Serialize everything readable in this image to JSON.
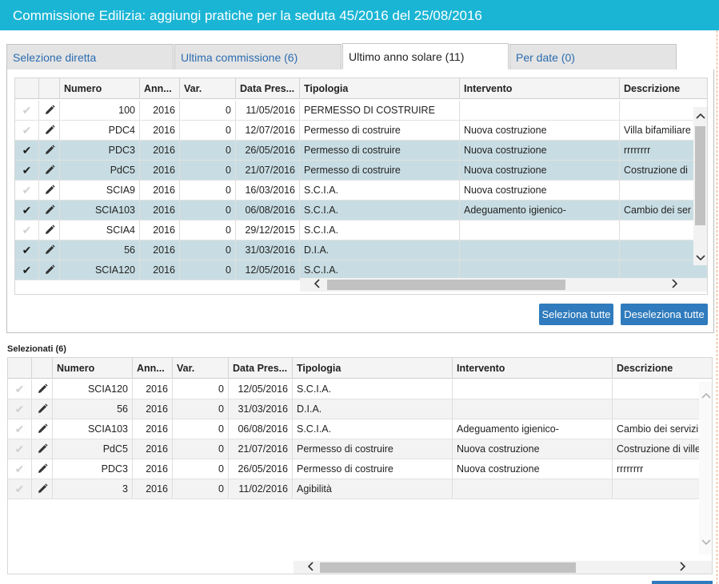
{
  "dialog": {
    "title": "Commissione Edilizia: aggiungi pratiche per la seduta 45/2016 del 25/08/2016"
  },
  "tabs": [
    {
      "label": "Selezione diretta",
      "active": false
    },
    {
      "label": "Ultima commissione (6)",
      "active": false
    },
    {
      "label": "Ultimo anno solare (11)",
      "active": true
    },
    {
      "label": "Per date (0)",
      "active": false
    }
  ],
  "columns": [
    "",
    "",
    "Numero",
    "Ann...",
    "Var.",
    "Data Pres...",
    "Tipologia",
    "Intervento",
    "Descrizione"
  ],
  "top_rows": [
    {
      "checked": false,
      "numero": "100",
      "anno": "2016",
      "var": "0",
      "data": "11/05/2016",
      "tipologia": "PERMESSO DI COSTRUIRE",
      "intervento": "",
      "descrizione": ""
    },
    {
      "checked": false,
      "numero": "PDC4",
      "anno": "2016",
      "var": "0",
      "data": "12/07/2016",
      "tipologia": "Permesso di costruire",
      "intervento": "Nuova costruzione",
      "descrizione": "Villa bifamiliare"
    },
    {
      "checked": true,
      "numero": "PDC3",
      "anno": "2016",
      "var": "0",
      "data": "26/05/2016",
      "tipologia": "Permesso di costruire",
      "intervento": "Nuova costruzione",
      "descrizione": "rrrrrrrr"
    },
    {
      "checked": true,
      "numero": "PdC5",
      "anno": "2016",
      "var": "0",
      "data": "21/07/2016",
      "tipologia": "Permesso di costruire",
      "intervento": "Nuova costruzione",
      "descrizione": "Costruzione di"
    },
    {
      "checked": false,
      "numero": "SCIA9",
      "anno": "2016",
      "var": "0",
      "data": "16/03/2016",
      "tipologia": "S.C.I.A.",
      "intervento": "Nuova costruzione",
      "descrizione": ""
    },
    {
      "checked": true,
      "numero": "SCIA103",
      "anno": "2016",
      "var": "0",
      "data": "06/08/2016",
      "tipologia": "S.C.I.A.",
      "intervento": "Adeguamento igienico-",
      "descrizione": "Cambio dei ser"
    },
    {
      "checked": false,
      "numero": "SCIA4",
      "anno": "2016",
      "var": "0",
      "data": "29/12/2015",
      "tipologia": "S.C.I.A.",
      "intervento": "",
      "descrizione": ""
    },
    {
      "checked": true,
      "numero": "56",
      "anno": "2016",
      "var": "0",
      "data": "31/03/2016",
      "tipologia": "D.I.A.",
      "intervento": "",
      "descrizione": ""
    },
    {
      "checked": true,
      "numero": "SCIA120",
      "anno": "2016",
      "var": "0",
      "data": "12/05/2016",
      "tipologia": "S.C.I.A.",
      "intervento": "",
      "descrizione": ""
    }
  ],
  "buttons": {
    "select_all": "Seleziona tutte",
    "deselect_all": "Deseleziona tutte"
  },
  "selected_section": {
    "label": "Selezionati (6)"
  },
  "bottom_rows": [
    {
      "numero": "SCIA120",
      "anno": "2016",
      "var": "0",
      "data": "12/05/2016",
      "tipologia": "S.C.I.A.",
      "intervento": "",
      "descrizione": ""
    },
    {
      "numero": "56",
      "anno": "2016",
      "var": "0",
      "data": "31/03/2016",
      "tipologia": "D.I.A.",
      "intervento": "",
      "descrizione": ""
    },
    {
      "numero": "SCIA103",
      "anno": "2016",
      "var": "0",
      "data": "06/08/2016",
      "tipologia": "S.C.I.A.",
      "intervento": "Adeguamento igienico-",
      "descrizione": "Cambio dei servizi"
    },
    {
      "numero": "PdC5",
      "anno": "2016",
      "var": "0",
      "data": "21/07/2016",
      "tipologia": "Permesso di costruire",
      "intervento": "Nuova costruzione",
      "descrizione": "Costruzione di ville"
    },
    {
      "numero": "PDC3",
      "anno": "2016",
      "var": "0",
      "data": "26/05/2016",
      "tipologia": "Permesso di costruire",
      "intervento": "Nuova costruzione",
      "descrizione": "rrrrrrrr"
    },
    {
      "numero": "3",
      "anno": "2016",
      "var": "0",
      "data": "11/02/2016",
      "tipologia": "Agibilità",
      "intervento": "",
      "descrizione": ""
    }
  ],
  "icons": {
    "check": "check-icon",
    "edit": "pencil-icon",
    "scroll_up": "chevron-up-icon",
    "scroll_down": "chevron-down-icon",
    "scroll_left": "chevron-left-icon",
    "scroll_right": "chevron-right-icon"
  },
  "colors": {
    "title_bar": "#1ab5d5",
    "selected_row": "#c8dde3",
    "button": "#2f7bbd",
    "tab_link": "#2b6cb0"
  }
}
